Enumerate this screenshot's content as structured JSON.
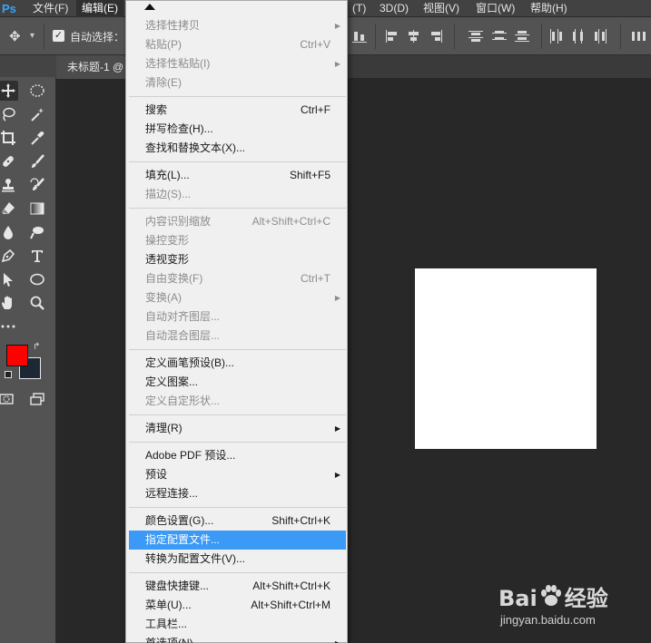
{
  "app": {
    "logo": "Ps"
  },
  "menubar": {
    "items": [
      {
        "label": "文件(F)",
        "active": false
      },
      {
        "label": "编辑(E)",
        "active": true
      },
      {
        "label": "(T)"
      },
      {
        "label": "3D(D)"
      },
      {
        "label": "视图(V)"
      },
      {
        "label": "窗口(W)"
      },
      {
        "label": "帮助(H)"
      }
    ]
  },
  "options": {
    "auto_select_label": "自动选择：",
    "auto_select_checked": true
  },
  "tabs": [
    {
      "label": "未标题-1 @"
    }
  ],
  "colors": {
    "foreground": "#ff0000",
    "background": "#1c2935",
    "highlight": "#3c9af7"
  },
  "edit_menu": {
    "sections": [
      [
        {
          "label": "选择性拷贝",
          "shortcut": "",
          "submenu": true,
          "disabled": true
        },
        {
          "label": "粘贴(P)",
          "shortcut": "Ctrl+V",
          "submenu": false,
          "disabled": true
        },
        {
          "label": "选择性粘贴(I)",
          "shortcut": "",
          "submenu": true,
          "disabled": true
        },
        {
          "label": "清除(E)",
          "shortcut": "",
          "submenu": false,
          "disabled": true
        }
      ],
      [
        {
          "label": "搜索",
          "shortcut": "Ctrl+F",
          "submenu": false,
          "disabled": false
        },
        {
          "label": "拼写检查(H)...",
          "shortcut": "",
          "submenu": false,
          "disabled": false
        },
        {
          "label": "查找和替换文本(X)...",
          "shortcut": "",
          "submenu": false,
          "disabled": false
        }
      ],
      [
        {
          "label": "填充(L)...",
          "shortcut": "Shift+F5",
          "submenu": false,
          "disabled": false
        },
        {
          "label": "描边(S)...",
          "shortcut": "",
          "submenu": false,
          "disabled": true
        }
      ],
      [
        {
          "label": "内容识别缩放",
          "shortcut": "Alt+Shift+Ctrl+C",
          "submenu": false,
          "disabled": true
        },
        {
          "label": "操控变形",
          "shortcut": "",
          "submenu": false,
          "disabled": true
        },
        {
          "label": "透视变形",
          "shortcut": "",
          "submenu": false,
          "disabled": false
        },
        {
          "label": "自由变换(F)",
          "shortcut": "Ctrl+T",
          "submenu": false,
          "disabled": true
        },
        {
          "label": "变换(A)",
          "shortcut": "",
          "submenu": true,
          "disabled": true
        },
        {
          "label": "自动对齐图层...",
          "shortcut": "",
          "submenu": false,
          "disabled": true
        },
        {
          "label": "自动混合图层...",
          "shortcut": "",
          "submenu": false,
          "disabled": true
        }
      ],
      [
        {
          "label": "定义画笔预设(B)...",
          "shortcut": "",
          "submenu": false,
          "disabled": false
        },
        {
          "label": "定义图案...",
          "shortcut": "",
          "submenu": false,
          "disabled": false
        },
        {
          "label": "定义自定形状...",
          "shortcut": "",
          "submenu": false,
          "disabled": true
        }
      ],
      [
        {
          "label": "清理(R)",
          "shortcut": "",
          "submenu": true,
          "disabled": false
        }
      ],
      [
        {
          "label": "Adobe PDF 预设...",
          "shortcut": "",
          "submenu": false,
          "disabled": false
        },
        {
          "label": "预设",
          "shortcut": "",
          "submenu": true,
          "disabled": false
        },
        {
          "label": "远程连接...",
          "shortcut": "",
          "submenu": false,
          "disabled": false
        }
      ],
      [
        {
          "label": "颜色设置(G)...",
          "shortcut": "Shift+Ctrl+K",
          "submenu": false,
          "disabled": false
        },
        {
          "label": "指定配置文件...",
          "shortcut": "",
          "submenu": false,
          "disabled": false,
          "highlighted": true
        },
        {
          "label": "转换为配置文件(V)...",
          "shortcut": "",
          "submenu": false,
          "disabled": false
        }
      ],
      [
        {
          "label": "键盘快捷键...",
          "shortcut": "Alt+Shift+Ctrl+K",
          "submenu": false,
          "disabled": false
        },
        {
          "label": "菜单(U)...",
          "shortcut": "Alt+Shift+Ctrl+M",
          "submenu": false,
          "disabled": false
        },
        {
          "label": "工具栏...",
          "shortcut": "",
          "submenu": false,
          "disabled": false
        },
        {
          "label": "首选项(N)",
          "shortcut": "",
          "submenu": true,
          "disabled": false
        }
      ]
    ]
  },
  "watermark": {
    "logo_left": "Bai",
    "logo_right": "经验",
    "url": "jingyan.baidu.com"
  }
}
